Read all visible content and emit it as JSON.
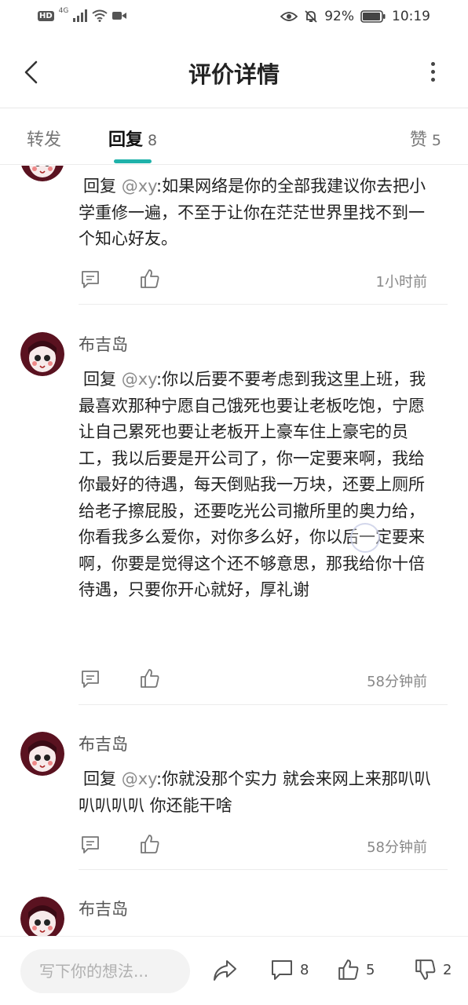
{
  "status_bar": {
    "hd": "HD",
    "network": "4G",
    "battery": "92%",
    "time": "10:19"
  },
  "header": {
    "title": "评价详情"
  },
  "tabs": {
    "forward_label": "转发",
    "reply_label": "回复",
    "reply_count": "8",
    "like_label": "赞",
    "like_count": "5"
  },
  "comments": [
    {
      "reply_prefix": "回复 ",
      "mention": "@xy",
      "text": ":如果网络是你的全部我建议你去把小学重修一遍，不至于让你在茫茫世界里找不到一个知心好友。",
      "time": "1小时前"
    },
    {
      "username": "布吉岛",
      "reply_prefix": "回复 ",
      "mention": "@xy",
      "text": ":你以后要不要考虑到我这里上班，我最喜欢那种宁愿自己饿死也要让老板吃饱，宁愿让自己累死也要让老板开上豪车住上豪宅的员工，我以后要是开公司了，你一定要来啊，我给你最好的待遇，每天倒贴我一万块，还要上厕所给老子擦屁股，还要吃光公司撤所里的奥力给，你看我多么爱你，对你多么好，你以后一定要来啊，你要是觉得这个还不够意思，那我给你十倍待遇，只要你开心就好，厚礼谢",
      "time": "58分钟前"
    },
    {
      "username": "布吉岛",
      "reply_prefix": "回复 ",
      "mention": "@xy",
      "text": ":你就没那个实力 就会来网上来那叭叭叭叭叭叭 你还能干啥",
      "time": "58分钟前"
    },
    {
      "username": "布吉岛"
    }
  ],
  "bottom_bar": {
    "input_placeholder": "写下你的想法...",
    "comment_count": "8",
    "like_count": "5",
    "dislike_count": "2"
  },
  "colors": {
    "accent": "#20b2aa",
    "mention": "#8a8a8a",
    "avatar_hair": "#5a1220"
  }
}
